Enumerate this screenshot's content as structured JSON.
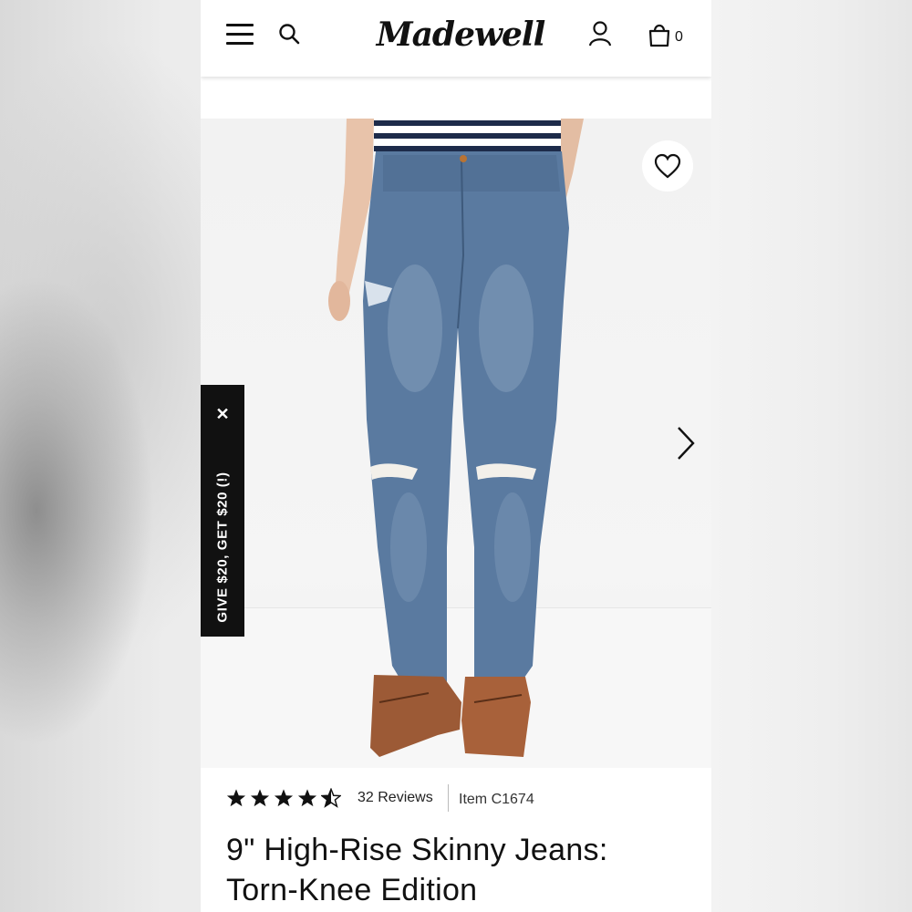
{
  "header": {
    "logo_text": "Madewell",
    "bag_count": "0",
    "icons": [
      "menu-icon",
      "search-icon",
      "account-icon",
      "shopping-bag-icon"
    ]
  },
  "hero": {
    "icons": [
      "heart-icon",
      "chevron-right-icon"
    ]
  },
  "promo": {
    "label": "GIVE $20, GET $20 (!)",
    "close": "✕"
  },
  "product": {
    "rating": 4.5,
    "reviews_label": "32 Reviews",
    "item_label": "Item C1674",
    "title_line1": "9\" High-Rise Skinny Jeans:",
    "title_line2": "Torn-Knee Edition"
  },
  "colors": {
    "denim": "#4f6f93",
    "shoe": "#a0522d",
    "promo_bg": "#111111"
  }
}
